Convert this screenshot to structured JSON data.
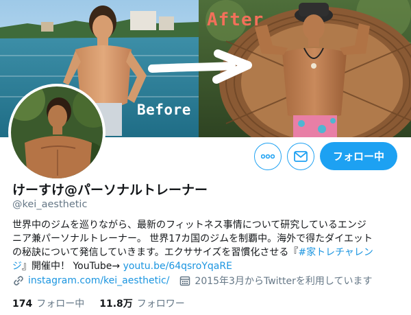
{
  "banner": {
    "after_label": "After",
    "before_label": "Before"
  },
  "actions": {
    "follow_label": "フォロー中"
  },
  "profile": {
    "name": "けーすけ@パーソナルトレーナー",
    "handle": "@kei_aesthetic",
    "bio_lines": [
      "世界中のジムを巡りながら、最新のフィットネス事情について研究しているエンジ",
      "ニア兼パーソナルトレーナー。 世界17カ国のジムを制覇中。海外で得たダイエット",
      "の秘訣について発信していきます。エクササイズを習慣化させる『"
    ],
    "bio_hashtag": "#家トレチャレン",
    "bio_hashtag_cont": "ジ",
    "bio_line4_text": "』開催中！ YouTube→ ",
    "bio_youtube_link": "youtu.be/64qsroYqaRE",
    "website": "instagram.com/kei_aesthetic/",
    "joined": "2015年3月からTwitterを利用しています"
  },
  "stats": {
    "following_count": "174",
    "following_label": "フォロー中",
    "followers_count": "11.8万",
    "followers_label": "フォロワー"
  },
  "colors": {
    "accent": "#1da1f2",
    "link": "#1b95e0",
    "secondary_text": "#657786",
    "after_label": "#f2705a"
  },
  "icons": [
    "more-icon",
    "mail-icon",
    "link-icon",
    "calendar-icon",
    "arrow-icon"
  ]
}
